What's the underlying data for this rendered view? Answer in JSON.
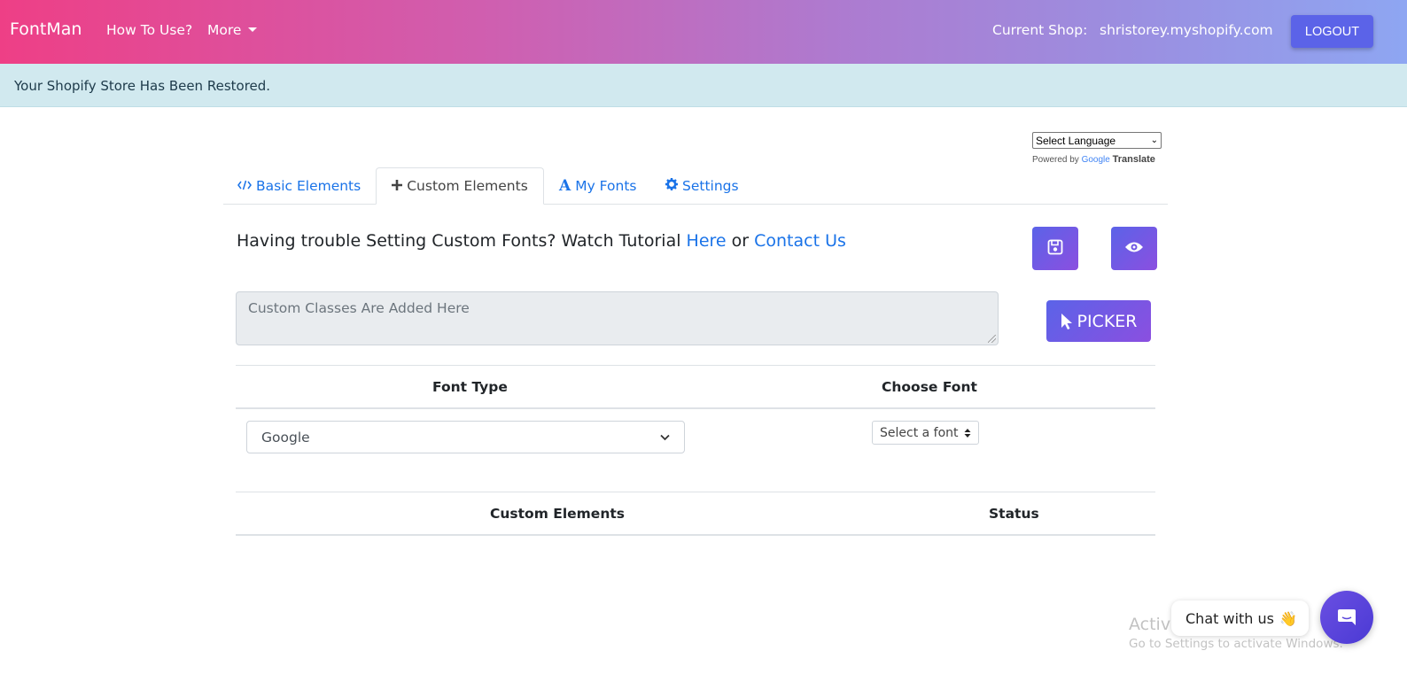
{
  "navbar": {
    "brand": "FontMan",
    "how_to_use": "How To Use?",
    "more": "More",
    "shop_label": "Current Shop:",
    "shop_name": "shristorey.myshopify.com",
    "logout": "LOGOUT"
  },
  "alert": {
    "message": "Your Shopify Store Has Been Restored."
  },
  "translate": {
    "select_label": "Select Language",
    "powered_by": "Powered by",
    "google": "Google",
    "translate": "Translate"
  },
  "tabs": [
    {
      "label": "Basic Elements",
      "icon": "code-icon"
    },
    {
      "label": "Custom Elements",
      "icon": "plus-icon",
      "active": true
    },
    {
      "label": "My Fonts",
      "icon": "font-icon"
    },
    {
      "label": "Settings",
      "icon": "gear-icon"
    }
  ],
  "trouble": {
    "prefix": "Having trouble Setting Custom Fonts? Watch Tutorial ",
    "here": "Here",
    "or": " or ",
    "contact": "Contact Us"
  },
  "custom_classes": {
    "placeholder": "Custom Classes Are Added Here"
  },
  "picker": {
    "label": "PICKER"
  },
  "font_table": {
    "headers": [
      "Font Type",
      "Choose Font"
    ],
    "font_type_value": "Google",
    "choose_font_value": "Select a font"
  },
  "elements_table": {
    "headers": [
      "Custom Elements",
      "Status"
    ]
  },
  "watermark": {
    "line1": "Activate Windows",
    "line2": "Go to Settings to activate Windows."
  },
  "chat": {
    "label": "Chat with us",
    "emoji": "👋"
  },
  "colors": {
    "accent": "#5b63e8",
    "link": "#1a73e8",
    "alert_bg": "#d1e9ef"
  }
}
